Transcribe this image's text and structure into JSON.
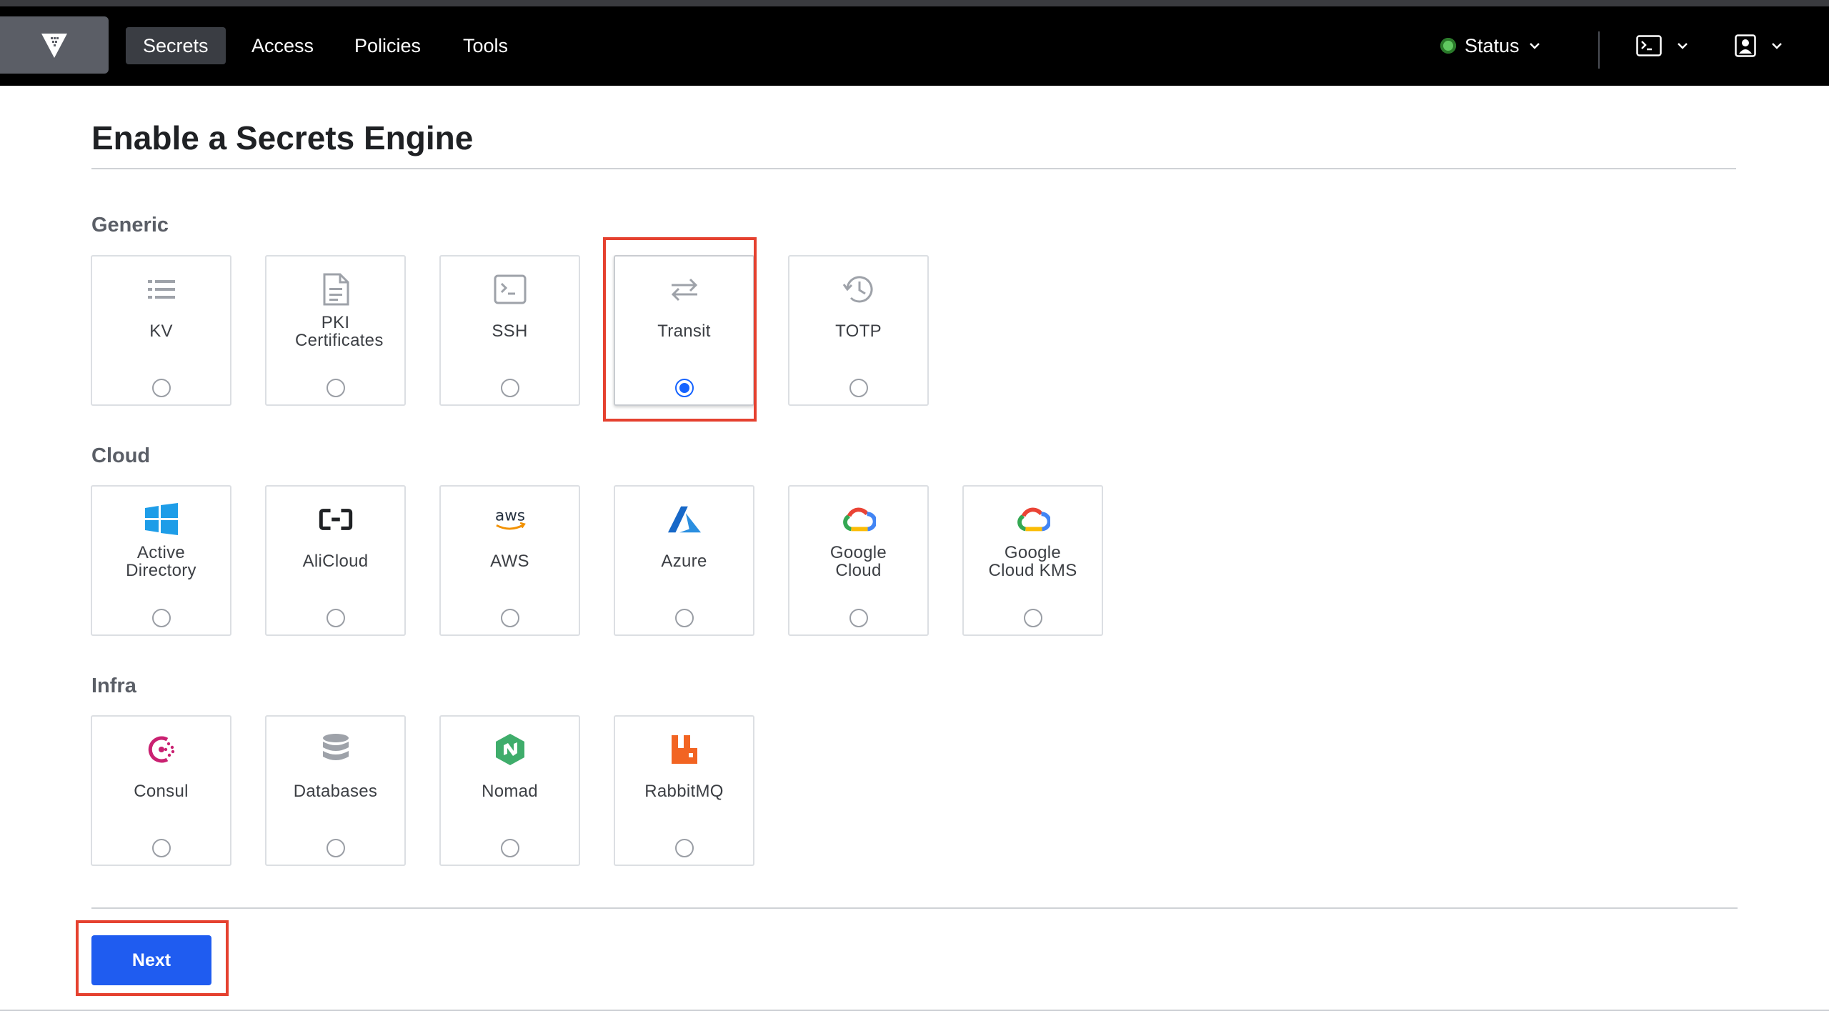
{
  "nav": {
    "items": [
      {
        "label": "Secrets",
        "active": true
      },
      {
        "label": "Access",
        "active": false
      },
      {
        "label": "Policies",
        "active": false
      },
      {
        "label": "Tools",
        "active": false
      }
    ],
    "status_label": "Status",
    "status_color": "#60c860"
  },
  "page": {
    "title": "Enable a Secrets Engine",
    "next_label": "Next"
  },
  "sections": [
    {
      "label": "Generic",
      "engines": [
        {
          "label": "KV",
          "icon": "list-icon"
        },
        {
          "label": "PKI Certificates",
          "icon": "certificate-icon"
        },
        {
          "label": "SSH",
          "icon": "terminal-icon"
        },
        {
          "label": "Transit",
          "icon": "swap-arrows-icon",
          "selected": true
        },
        {
          "label": "TOTP",
          "icon": "history-icon"
        }
      ]
    },
    {
      "label": "Cloud",
      "engines": [
        {
          "label": "Active Directory",
          "icon": "windows-logo-icon"
        },
        {
          "label": "AliCloud",
          "icon": "alicloud-logo-icon"
        },
        {
          "label": "AWS",
          "icon": "aws-logo-icon"
        },
        {
          "label": "Azure",
          "icon": "azure-logo-icon"
        },
        {
          "label": "Google Cloud",
          "icon": "google-cloud-logo-icon"
        },
        {
          "label": "Google Cloud KMS",
          "icon": "google-cloud-logo-icon"
        }
      ]
    },
    {
      "label": "Infra",
      "engines": [
        {
          "label": "Consul",
          "icon": "consul-logo-icon"
        },
        {
          "label": "Databases",
          "icon": "database-icon"
        },
        {
          "label": "Nomad",
          "icon": "nomad-logo-icon"
        },
        {
          "label": "RabbitMQ",
          "icon": "rabbitmq-logo-icon"
        }
      ]
    }
  ],
  "colors": {
    "accent": "#1563ff",
    "highlight": "#e5412f",
    "navbar": "#000000"
  }
}
